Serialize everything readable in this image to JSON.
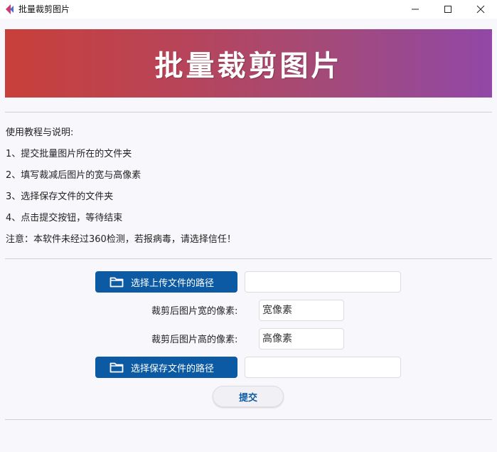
{
  "window": {
    "title": "批量裁剪图片",
    "icon": "app-logo-icon",
    "controls": [
      "minimize-icon",
      "maximize-icon",
      "close-icon"
    ]
  },
  "banner": {
    "title": "批量裁剪图片"
  },
  "instructions": {
    "heading": "使用教程与说明:",
    "steps": [
      "1、提交批量图片所在的文件夹",
      "2、填写裁减后图片的宽与高像素",
      "3、选择保存文件的文件夹",
      "4、点击提交按钮，等待结束"
    ],
    "note": "注意：本软件未经过360检测，若报病毒，请选择信任！"
  },
  "form": {
    "upload_button_label": "选择上传文件的路径",
    "upload_path_value": "",
    "width_label": "裁剪后图片宽的像素:",
    "width_placeholder": "宽像素",
    "height_label": "裁剪后图片高的像素:",
    "height_placeholder": "高像素",
    "save_button_label": "选择保存文件的路径",
    "save_path_value": "",
    "submit_label": "提交",
    "folder_icon": "folder-icon"
  },
  "colors": {
    "primary": "#0b5aa3",
    "banner_start": "#c8403a",
    "banner_end": "#9148a6",
    "background": "#f8f8fc"
  }
}
